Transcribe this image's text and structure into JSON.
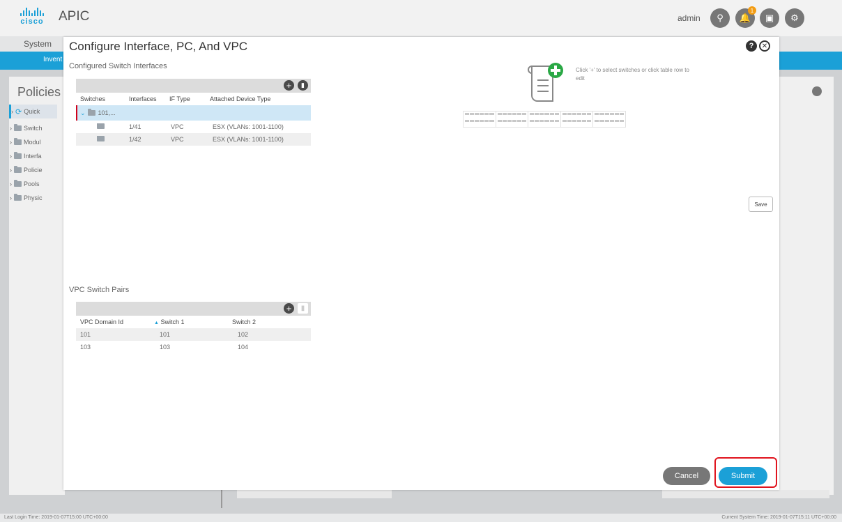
{
  "header": {
    "brand": "cisco",
    "app_title": "APIC",
    "user": "admin",
    "notification_count": "1",
    "icons": [
      "search-icon",
      "bell-icon",
      "screen-icon",
      "gear-icon"
    ]
  },
  "menu": {
    "system": "System",
    "inventory": "Invent"
  },
  "left_nav": {
    "title": "Policies",
    "items": [
      "Quick",
      "Switch",
      "Modul",
      "Interfa",
      "Policie",
      "Pools",
      "Physic"
    ]
  },
  "modal": {
    "title": "Configure Interface, PC, And VPC",
    "configured_label": "Configured Switch Interfaces",
    "interfaces_table": {
      "columns": [
        "Switches",
        "Interfaces",
        "IF Type",
        "Attached Device Type"
      ],
      "group_row": "101,...",
      "rows": [
        {
          "interface": "1/41",
          "if_type": "VPC",
          "device": "ESX (VLANs: 1001-1100)"
        },
        {
          "interface": "1/42",
          "if_type": "VPC",
          "device": "ESX (VLANs: 1001-1100)"
        }
      ]
    },
    "hint_text": "Click '+' to select switches or click table row to edit",
    "vpc_label": "VPC Switch Pairs",
    "vpc_table": {
      "columns": [
        "VPC Domain Id",
        "Switch 1",
        "Switch 2"
      ],
      "sort_indicator": "▲",
      "rows": [
        {
          "domain": "101",
          "s1": "101",
          "s2": "102"
        },
        {
          "domain": "103",
          "s1": "103",
          "s2": "104"
        }
      ]
    },
    "save_label": "Save",
    "cancel_label": "Cancel",
    "submit_label": "Submit"
  },
  "footer": {
    "last_login": "Last Login Time: 2019-01-07T15:00 UTC+00:00",
    "current_time": "Current System Time: 2019-01-07T15:11 UTC+00:00"
  },
  "colors": {
    "accent": "#1ba0d7",
    "highlight": "#e0141e",
    "add_icon": "#2aa845"
  }
}
